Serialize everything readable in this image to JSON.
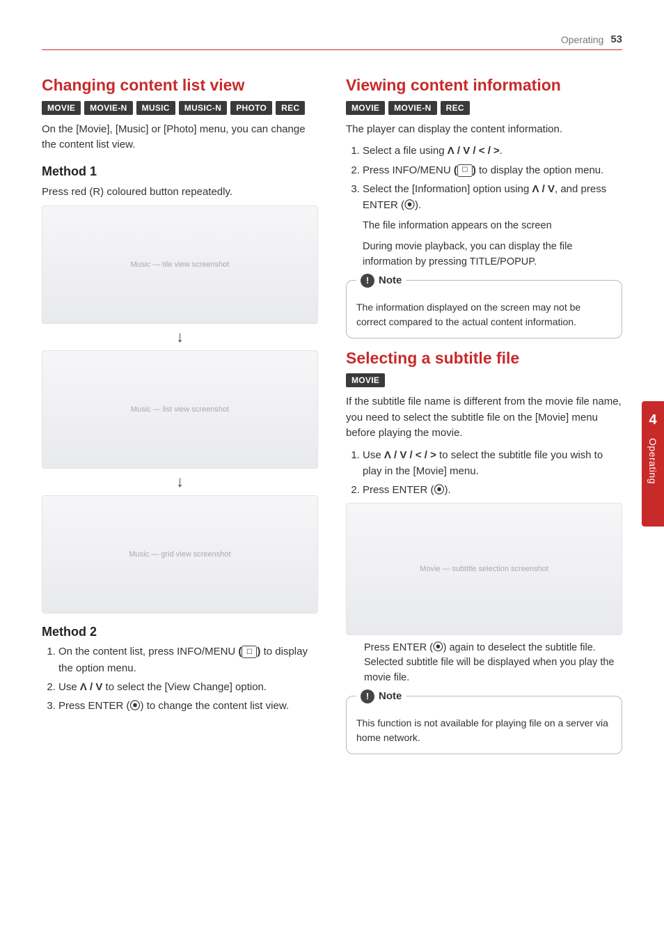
{
  "header": {
    "section": "Operating",
    "page": "53"
  },
  "sideTab": {
    "num": "4",
    "text": "Operating"
  },
  "common": {
    "noteLabel": "Note",
    "bang": "!"
  },
  "icons": {
    "optionMenu": "☐",
    "enter": "⦿",
    "arrowKeys": "Λ / V / < / >",
    "upDown": "Λ / V"
  },
  "left": {
    "h1": "Changing content list view",
    "tags": [
      "MOVIE",
      "MOVIE-N",
      "MUSIC",
      "MUSIC-N",
      "PHOTO",
      "REC"
    ],
    "intro": "On the [Movie], [Music] or [Photo] menu, you can change the content list view.",
    "method1": {
      "title": "Method 1",
      "text": "Press red (R) coloured button repeatedly.",
      "fig1": "Music — tile view screenshot",
      "fig2": "Music — list view screenshot",
      "fig3": "Music — grid view screenshot",
      "arrow": "↓"
    },
    "method2": {
      "title": "Method 2",
      "steps": {
        "s1_a": "On the content list, press INFO/MENU ",
        "s1_b": " to display the option menu.",
        "s2_a": "Use ",
        "s2_b": " to select the [View Change] option.",
        "s3_a": "Press ENTER (",
        "s3_b": ") to change the content list view."
      }
    }
  },
  "right": {
    "h1": "Viewing content information",
    "tags": [
      "MOVIE",
      "MOVIE-N",
      "REC"
    ],
    "intro": "The player can display the content information.",
    "steps": {
      "s1_a": "Select a file using ",
      "s1_b": ".",
      "s2_a": "Press INFO/MENU ",
      "s2_b": " to display the option menu.",
      "s3_a": "Select the [Information] option using ",
      "s3_b": ", and press ENTER (",
      "s3_c": ")."
    },
    "afterSteps": {
      "line1": "The file information appears on the screen",
      "line2": "During movie playback, you can display the file information by pressing TITLE/POPUP."
    },
    "note1": "The information displayed on the screen may not be correct compared to the actual content information.",
    "h2": "Selecting a subtitle file",
    "tags2": [
      "MOVIE"
    ],
    "intro2": "If the subtitle file name is different from the movie file name, you need to select the subtitle file on the [Movie] menu before playing the movie.",
    "steps2": {
      "s1_a": "Use ",
      "s1_b": " to select the subtitle file you wish to play in the [Movie] menu.",
      "s2_a": "Press ENTER (",
      "s2_b": ")."
    },
    "fig": "Movie — subtitle selection screenshot",
    "after2_a": "Press ENTER (",
    "after2_b": ") again to deselect the subtitle file. Selected subtitle file will be displayed when you play the movie file.",
    "note2": "This function is not available for playing file on a server via home network."
  }
}
